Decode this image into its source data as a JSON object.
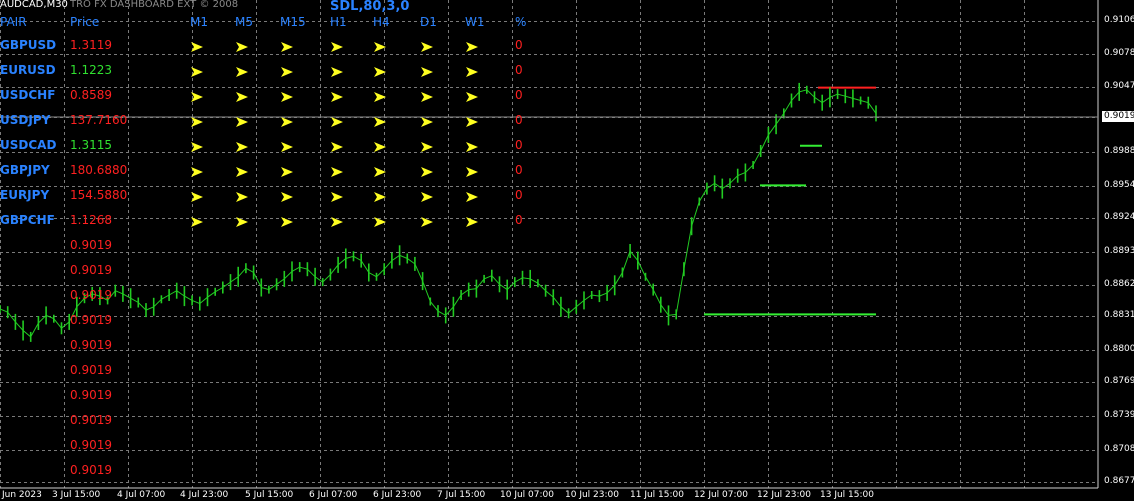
{
  "window": {
    "symbol_label": "AUDCAD,M30"
  },
  "indicator": {
    "watermark": "TRO FX DASHBOARD EXT  © 2008",
    "title": "SDL,80,3,0"
  },
  "dashboard": {
    "headers": [
      "PAIR",
      "Price",
      "M1",
      "M5",
      "M15",
      "H1",
      "H4",
      "D1",
      "W1",
      "%"
    ],
    "rows": [
      {
        "pair": "GBPUSD",
        "price": "1.3119",
        "price_color": "#ff2020",
        "pct": "0"
      },
      {
        "pair": "EURUSD",
        "price": "1.1223",
        "price_color": "#30e030",
        "pct": "0"
      },
      {
        "pair": "USDCHF",
        "price": "0.8589",
        "price_color": "#ff2020",
        "pct": "0"
      },
      {
        "pair": "USDJPY",
        "price": "137.7160",
        "price_color": "#ff2020",
        "pct": "0"
      },
      {
        "pair": "USDCAD",
        "price": "1.3115",
        "price_color": "#30e030",
        "pct": "0"
      },
      {
        "pair": "GBPJPY",
        "price": "180.6880",
        "price_color": "#ff2020",
        "pct": "0"
      },
      {
        "pair": "EURJPY",
        "price": "154.5880",
        "price_color": "#ff2020",
        "pct": "0"
      },
      {
        "pair": "GBPCHF",
        "price": "1.1268",
        "price_color": "#ff2020",
        "pct": "0"
      }
    ],
    "arrow_icon": "yellow-arrow-right-icon",
    "extra_prices": [
      "0.9019",
      "0.9019",
      "0.9019",
      "0.9019",
      "0.9019",
      "0.9019",
      "0.9019",
      "0.9019",
      "0.9019",
      "0.9019"
    ]
  },
  "chart_data": {
    "type": "line",
    "instrument": "AUDCAD",
    "timeframe": "M30",
    "y_ticks": [
      "0.9106",
      "0.9078",
      "0.9047",
      "0.9019",
      "0.8988",
      "0.8954",
      "0.8924",
      "0.8893",
      "0.8862",
      "0.8831",
      "0.8800",
      "0.8769",
      "0.8739",
      "0.8708",
      "0.8677"
    ],
    "x_ticks": [
      "Jun 2023",
      "3 Jul 15:00",
      "4 Jul 07:00",
      "4 Jul 23:00",
      "5 Jul 15:00",
      "6 Jul 07:00",
      "6 Jul 23:00",
      "7 Jul 15:00",
      "10 Jul 07:00",
      "10 Jul 23:00",
      "11 Jul 15:00",
      "12 Jul 07:00",
      "12 Jul 23:00",
      "13 Jul 15:00"
    ],
    "current_price": "0.9019",
    "ylim": [
      0.8677,
      0.9106
    ],
    "series": [
      {
        "color": "#22cc22",
        "values": [
          0.8838,
          0.8835,
          0.8826,
          0.8818,
          0.8812,
          0.8825,
          0.8832,
          0.8829,
          0.882,
          0.8826,
          0.884,
          0.8848,
          0.8852,
          0.885,
          0.8846,
          0.8855,
          0.8852,
          0.8848,
          0.8844,
          0.8837,
          0.884,
          0.8847,
          0.8851,
          0.8855,
          0.885,
          0.8846,
          0.8843,
          0.8849,
          0.8854,
          0.8858,
          0.8863,
          0.8868,
          0.8876,
          0.8872,
          0.8858,
          0.8856,
          0.8861,
          0.8866,
          0.8873,
          0.8877,
          0.8875,
          0.8868,
          0.8863,
          0.887,
          0.8879,
          0.8885,
          0.8887,
          0.8883,
          0.8872,
          0.8868,
          0.8875,
          0.8883,
          0.8888,
          0.8885,
          0.888,
          0.8864,
          0.8845,
          0.8836,
          0.8832,
          0.884,
          0.8851,
          0.8856,
          0.8857,
          0.8866,
          0.8869,
          0.8861,
          0.8856,
          0.8863,
          0.8867,
          0.8866,
          0.8862,
          0.8855,
          0.8849,
          0.884,
          0.8834,
          0.884,
          0.8846,
          0.8851,
          0.885,
          0.8853,
          0.886,
          0.8872,
          0.8892,
          0.8883,
          0.8868,
          0.8856,
          0.8842,
          0.8832,
          0.8833,
          0.8875,
          0.8915,
          0.8938,
          0.895,
          0.8955,
          0.895,
          0.8955,
          0.8962,
          0.8965,
          0.8972,
          0.8985,
          0.9,
          0.901,
          0.902,
          0.9032,
          0.904,
          0.9042,
          0.9035,
          0.903,
          0.9035,
          0.9038,
          0.9036,
          0.9034,
          0.9032,
          0.903,
          0.902
        ]
      }
    ],
    "levels": [
      {
        "name": "support",
        "value": 0.8833,
        "color": "#33ee33"
      },
      {
        "name": "resistance",
        "value": 0.9044,
        "color": "#ff2020"
      },
      {
        "name": "minor-level-1",
        "value": 0.8953,
        "color": "#33ee33"
      },
      {
        "name": "minor-level-2",
        "value": 0.899,
        "color": "#33ee33"
      }
    ]
  }
}
